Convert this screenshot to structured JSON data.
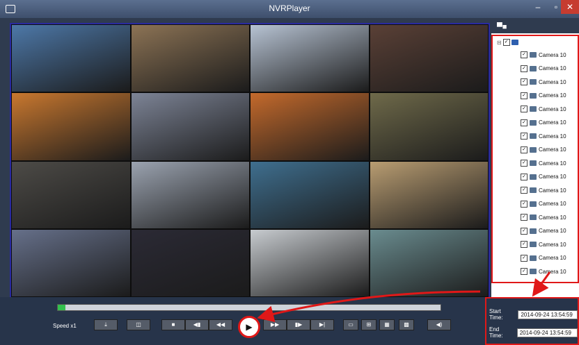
{
  "window": {
    "title": "NVRPlayer",
    "min_icon": "minimize-icon",
    "max_icon": "maximize-icon",
    "close_icon": "close-icon"
  },
  "video_grid": {
    "rows": 4,
    "cols": 4,
    "feeds": [
      {
        "scene": "eiffel-tower",
        "color": "#4d78a8"
      },
      {
        "scene": "plaza-crowd",
        "color": "#8c7355"
      },
      {
        "scene": "bullet-train",
        "color": "#b7c3d3"
      },
      {
        "scene": "street-market",
        "color": "#5a4036"
      },
      {
        "scene": "ferris-wheel-sunset",
        "color": "#c9782f"
      },
      {
        "scene": "train-station",
        "color": "#7d8496"
      },
      {
        "scene": "red-bus",
        "color": "#c46a2c"
      },
      {
        "scene": "subway-car",
        "color": "#6f6a4a"
      },
      {
        "scene": "crosswalk",
        "color": "#4d4b47"
      },
      {
        "scene": "bus-terminal",
        "color": "#9ba3b0"
      },
      {
        "scene": "marina",
        "color": "#3f6f8f"
      },
      {
        "scene": "grocery-store",
        "color": "#b99d72"
      },
      {
        "scene": "mall-crowd",
        "color": "#66708a"
      },
      {
        "scene": "city-night",
        "color": "#2b2a35"
      },
      {
        "scene": "office-meeting",
        "color": "#c7cbcf"
      },
      {
        "scene": "glass-dome",
        "color": "#6a8c8f"
      }
    ]
  },
  "camera_tree": {
    "items": [
      "Camera 10",
      "Camera 10",
      "Camera 10",
      "Camera 10",
      "Camera 10",
      "Camera 10",
      "Camera 10",
      "Camera 10",
      "Camera 10",
      "Camera 10",
      "Camera 10",
      "Camera 10",
      "Camera 10",
      "Camera 10",
      "Camera 10",
      "Camera 10",
      "Camera 10"
    ]
  },
  "playback": {
    "speed_label": "Speed x1",
    "progress": 0.02,
    "start_label": "Start Time:",
    "start_value": "2014-09-24 13:54:59",
    "end_label": "End Time:",
    "end_value": "2014-09-24 13:54:59"
  },
  "colors": {
    "highlight": "#e01818",
    "accent": "#33c04d"
  }
}
